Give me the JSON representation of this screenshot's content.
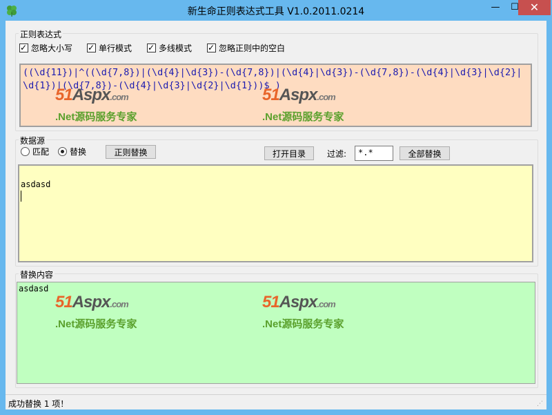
{
  "window": {
    "title": "新生命正则表达式工具 V1.0.2011.0214",
    "controls": {
      "minimize": "—",
      "maximize": "☐",
      "close": "✕"
    }
  },
  "regex_group": {
    "title": "正则表达式",
    "options": [
      {
        "label": "忽略大小写",
        "checked": true
      },
      {
        "label": "单行模式",
        "checked": true
      },
      {
        "label": "多线模式",
        "checked": true
      },
      {
        "label": "忽略正则中的空白",
        "checked": true
      }
    ],
    "pattern": "((\\d{11})|^((\\d{7,8})|(\\d{4}|\\d{3})-(\\d{7,8})|(\\d{4}|\\d{3})-(\\d{7,8})-(\\d{4}|\\d{3}|\\d{2}|\\d{1})|(\\d{7,8})-(\\d{4}|\\d{3}|\\d{2}|\\d{1}))$ )"
  },
  "watermark": {
    "brand_num": "51",
    "brand_name": "Aspx",
    "brand_domain": ".com",
    "tagline": ".Net源码服务专家"
  },
  "source_group": {
    "title": "数据源",
    "modes": [
      {
        "label": "匹配",
        "selected": false
      },
      {
        "label": "替换",
        "selected": true
      }
    ],
    "regex_replace_button": "正则替换",
    "open_dir_button": "打开目录",
    "filter_label": "过滤:",
    "filter_value": "*.*",
    "replace_all_button": "全部替换",
    "text": "asdasd"
  },
  "result_group": {
    "title": "替换内容",
    "text": "asdasd"
  },
  "statusbar": {
    "text": "成功替换 1 项！"
  },
  "colors": {
    "titlebar": "#67b8ee",
    "close_button": "#c7504f",
    "regex_bg": "#fedcc1",
    "source_bg": "#ffffc1",
    "result_bg": "#c0ffc0"
  }
}
